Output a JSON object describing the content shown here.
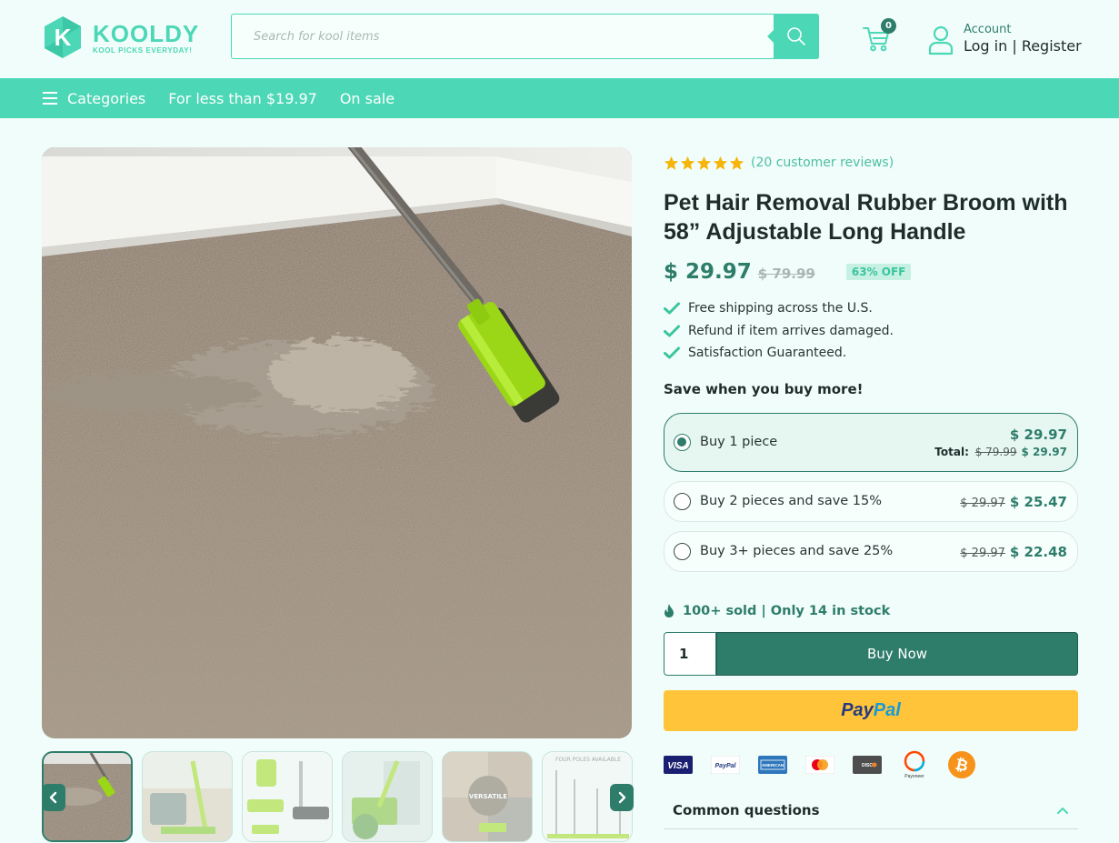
{
  "brand": {
    "name": "KOOLDY",
    "tagline": "KOOL PICKS EVERYDAY!",
    "accent": "#4cd7b6",
    "dark": "#2e7d6b"
  },
  "search": {
    "placeholder": "Search for kool items"
  },
  "cart": {
    "count": "0"
  },
  "account": {
    "label": "Account",
    "links": "Log in | Register"
  },
  "nav": {
    "categories": "Categories",
    "under_price": "For less than $19.97",
    "on_sale": "On sale"
  },
  "product": {
    "review_count_text": "(20 customer reviews)",
    "rating": 5,
    "title": "Pet Hair Removal Rubber Broom with 58” Adjustable Long Handle",
    "price": "$ 29.97",
    "old_price": "$ 79.99",
    "discount": "63% OFF",
    "benefits": [
      "Free shipping across the U.S.",
      "Refund if item arrives damaged.",
      "Satisfaction Guaranteed."
    ],
    "save_title": "Save when you buy more!",
    "options": [
      {
        "label": "Buy 1 piece",
        "price": "$ 29.97",
        "total_label": "Total:",
        "total_old": "$ 79.99",
        "total_new": "$ 29.97",
        "selected": true
      },
      {
        "label": "Buy 2 pieces and save 15%",
        "old": "$ 29.97",
        "price": "$ 25.47",
        "selected": false
      },
      {
        "label": "Buy 3+ pieces and save 25%",
        "old": "$ 29.97",
        "price": "$ 22.48",
        "selected": false
      }
    ],
    "stock": "100+ sold | Only 14 in stock",
    "quantity": "1",
    "buy_now": "Buy Now",
    "paypal": {
      "pay": "Pay",
      "pal": "Pal"
    },
    "payment_methods": [
      "VISA",
      "PayPal",
      "AMERICAN EXPRESS",
      "mastercard",
      "DISCOVER",
      "Payoneer",
      "bitcoin"
    ],
    "faq_title": "Common questions"
  },
  "gallery": {
    "thumbnail_count": 6,
    "active_index": 0,
    "thumb_text": [
      "",
      "",
      "",
      "",
      "VERSATILE",
      "FOUR POLES AVAILABLE"
    ]
  }
}
